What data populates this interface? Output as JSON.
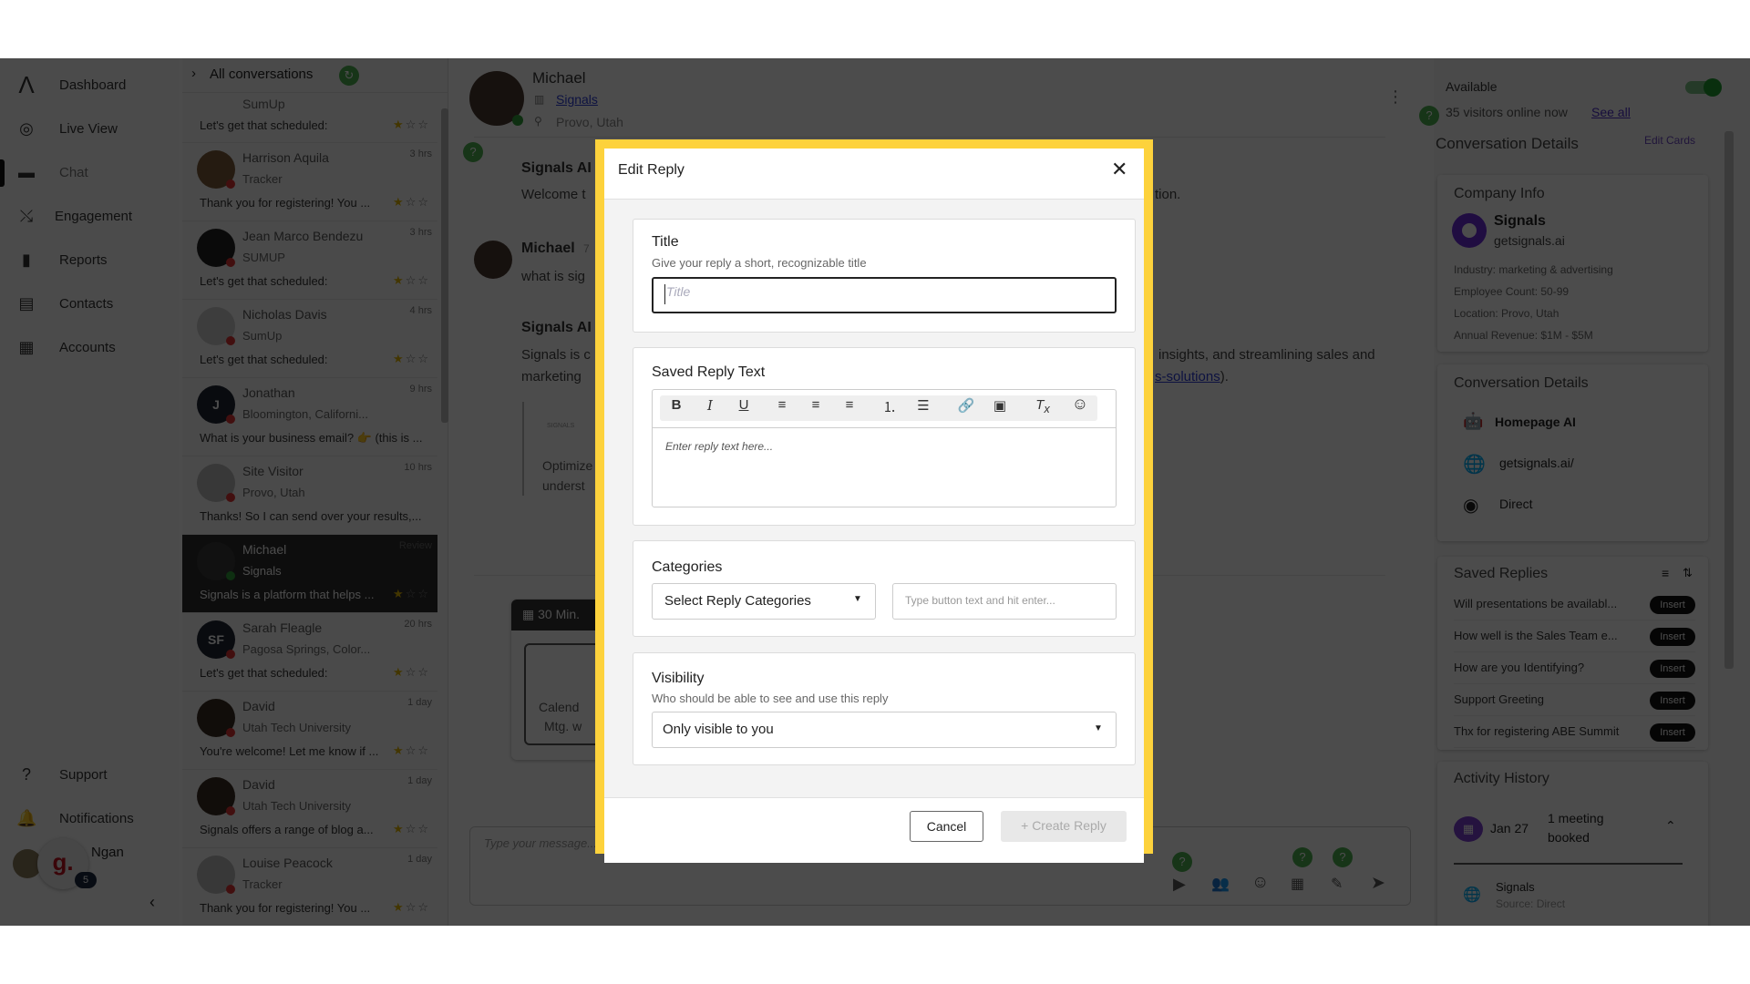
{
  "nav": {
    "items": [
      {
        "label": "Dashboard",
        "icon": "logo-icon"
      },
      {
        "label": "Live View",
        "icon": "live-view-icon"
      },
      {
        "label": "Chat",
        "icon": "chat-icon",
        "active": true
      },
      {
        "label": "Engagement",
        "icon": "engagement-icon"
      },
      {
        "label": "Reports",
        "icon": "reports-icon"
      },
      {
        "label": "Contacts",
        "icon": "contacts-icon"
      },
      {
        "label": "Accounts",
        "icon": "accounts-icon"
      }
    ],
    "support": "Support",
    "notifications": "Notifications",
    "user": "Ngan",
    "chat_badge": "5",
    "chat_logo": "g."
  },
  "list": {
    "header": "All conversations",
    "partial": {
      "sub": "SumUp",
      "preview": "Let's get that scheduled:"
    },
    "items": [
      {
        "name": "Harrison Aquila",
        "sub": "Tracker",
        "time": "3 hrs",
        "preview": "Thank you for registering! You ...",
        "stars": 1
      },
      {
        "name": "Jean Marco Bendezu",
        "sub": "SUMUP",
        "time": "3 hrs",
        "preview": "Let's get that scheduled:",
        "stars": 1
      },
      {
        "name": "Nicholas Davis",
        "sub": "SumUp",
        "time": "4 hrs",
        "preview": "Let's get that scheduled:",
        "stars": 1
      },
      {
        "name": "Jonathan",
        "initials": "J",
        "sub": "Bloomington, Californi...",
        "time": "9 hrs",
        "preview": "What is your business email? 👉 (this is ...",
        "stars": 0
      },
      {
        "name": "Site Visitor",
        "sub": "Provo, Utah",
        "time": "10 hrs",
        "preview": "Thanks! So I can send over your results,...",
        "stars": 0
      },
      {
        "name": "Michael",
        "sub": "Signals",
        "time": "Review",
        "preview": "Signals is a platform that helps ...",
        "stars": 1,
        "selected": true
      },
      {
        "name": "Sarah Fleagle",
        "initials": "SF",
        "sub": "Pagosa Springs, Color...",
        "time": "20 hrs",
        "preview": "Let's get that scheduled:",
        "stars": 1
      },
      {
        "name": "David",
        "sub": "Utah Tech University",
        "time": "1 day",
        "preview": "You're welcome! Let me know if ...",
        "stars": 1
      },
      {
        "name": "David",
        "sub": "Utah Tech University",
        "time": "1 day",
        "preview": "Signals offers a range of blog a...",
        "stars": 1
      },
      {
        "name": "Louise Peacock",
        "sub": "Tracker",
        "time": "1 day",
        "preview": "Thank you for registering! You ...",
        "stars": 1
      }
    ]
  },
  "chat": {
    "contact": {
      "name": "Michael",
      "company": "Signals",
      "location": "Provo, Utah"
    },
    "fragments": {
      "ai1": "Signals AI",
      "msg1_left": "Welcome t",
      "msg1_right": "tion.",
      "user": "Michael",
      "user_time": "7",
      "msg2_left": "what is sig",
      "ai2": "Signals AI",
      "msg3_l1": "Signals is c",
      "msg3_l2": "marketing",
      "msg3_r1": "insights, and streamlining sales and",
      "msg3_r2_link": "s-solutions",
      "msg3_r2_end": ").",
      "img_caption": "SIGNALS",
      "card_l1": "Optimize",
      "card_l2": "underst",
      "meeting_header": "30 Min.",
      "meeting_l1": "Calend",
      "meeting_l2": "Mtg. w"
    },
    "composer_placeholder": "Type your message..."
  },
  "right": {
    "status": "Available",
    "available": true,
    "visitors": "35 visitors online now",
    "see_all": "See all",
    "section_title": "Conversation Details",
    "edit_cards": "Edit Cards",
    "company": {
      "title": "Company Info",
      "name": "Signals",
      "domain": "getsignals.ai",
      "industry": "Industry: marketing & advertising",
      "employees": "Employee Count: 50-99",
      "location": "Location: Provo, Utah",
      "revenue": "Annual Revenue: $1M - $5M"
    },
    "details": {
      "title": "Conversation Details",
      "rows": [
        {
          "icon": "robot-icon",
          "label": "Homepage AI"
        },
        {
          "icon": "globe-icon",
          "label": "getsignals.ai/"
        },
        {
          "icon": "cursor-click-icon",
          "label": "Direct"
        }
      ]
    },
    "saved": {
      "title": "Saved Replies",
      "insert": "Insert",
      "items": [
        "Will presentations be availabl...",
        "How well is the Sales Team e...",
        "How are you Identifying?",
        "Support Greeting",
        "Thx for registering ABE Summit"
      ]
    },
    "activity": {
      "title": "Activity History",
      "date": "Jan 27",
      "summary_l1": "1 meeting",
      "summary_l2": "booked",
      "source_name": "Signals",
      "source": "Source: Direct"
    }
  },
  "modal": {
    "title": "Edit Reply",
    "title_label": "Title",
    "title_desc": "Give your reply a short, recognizable title",
    "title_placeholder": "Title",
    "title_value": "",
    "text_label": "Saved Reply Text",
    "text_placeholder": "Enter reply text here...",
    "categories_label": "Categories",
    "categories_select": "Select Reply Categories",
    "categories_input_placeholder": "Type button text and hit enter...",
    "visibility_label": "Visibility",
    "visibility_desc": "Who should be able to see and use this reply",
    "visibility_value": "Only visible to you",
    "cancel": "Cancel",
    "create": "Create Reply",
    "accent": "#fdd23c"
  }
}
